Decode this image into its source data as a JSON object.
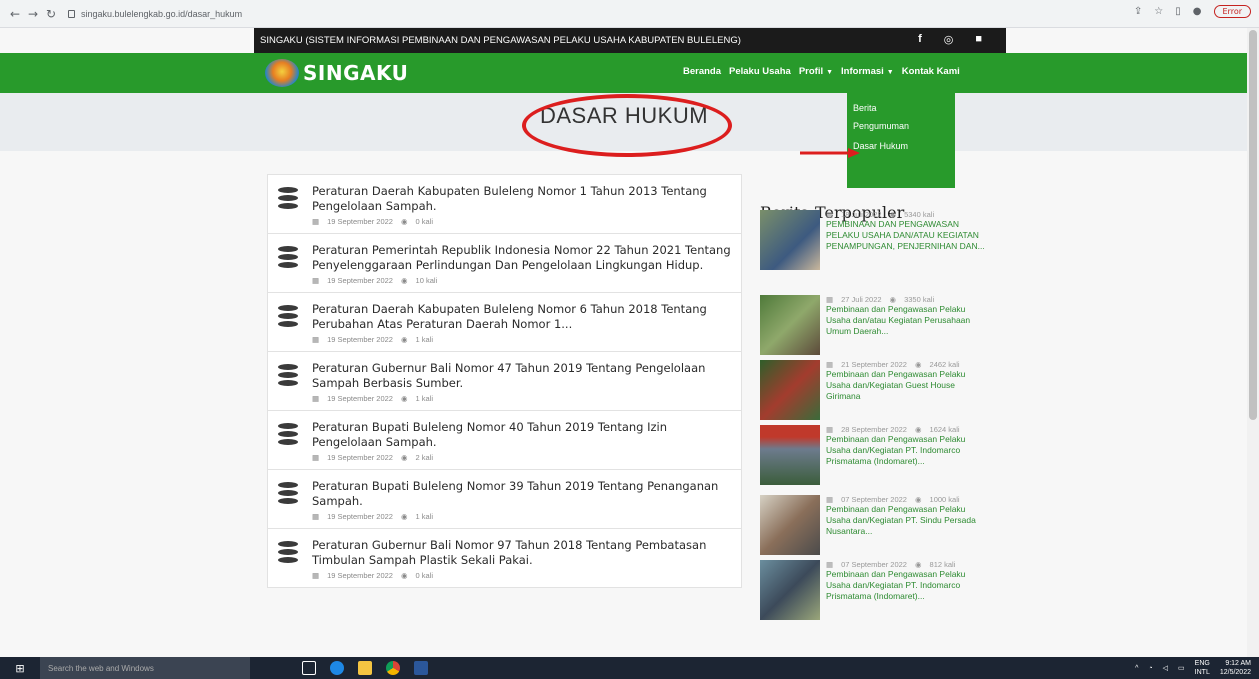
{
  "browser": {
    "url": "singaku.bulelengkab.go.id/dasar_hukum",
    "error_label": "Error"
  },
  "topbar": {
    "title": "SINGAKU (SISTEM INFORMASI PEMBINAAN DAN PENGAWASAN PELAKU USAHA KABUPATEN BULELENG)"
  },
  "brand": {
    "name": "SINGAKU"
  },
  "menu": {
    "beranda": "Beranda",
    "pelaku": "Pelaku Usaha",
    "profil": "Profil",
    "informasi": "Informasi",
    "kontak": "Kontak Kami"
  },
  "dropdown": {
    "items": [
      "Berita",
      "Pengumuman",
      "Dasar Hukum"
    ]
  },
  "page": {
    "title": "DASAR HUKUM"
  },
  "laws": [
    {
      "title": "Peraturan Daerah Kabupaten Buleleng Nomor 1 Tahun 2013 Tentang Pengelolaan Sampah.",
      "date": "19 September 2022",
      "views": "0 kali"
    },
    {
      "title": "Peraturan Pemerintah Republik Indonesia Nomor 22 Tahun 2021 Tentang Penyelenggaraan Perlindungan Dan Pengelolaan Lingkungan Hidup.",
      "date": "19 September 2022",
      "views": "10 kali"
    },
    {
      "title": "Peraturan Daerah Kabupaten Buleleng Nomor 6 Tahun 2018 Tentang Perubahan Atas Peraturan Daerah Nomor 1...",
      "date": "19 September 2022",
      "views": "1 kali"
    },
    {
      "title": "Peraturan Gubernur Bali Nomor 47 Tahun 2019 Tentang Pengelolaan Sampah Berbasis Sumber.",
      "date": "19 September 2022",
      "views": "1 kali"
    },
    {
      "title": "Peraturan Bupati Buleleng Nomor 40 Tahun 2019 Tentang Izin Pengelolaan Sampah.",
      "date": "19 September 2022",
      "views": "2 kali"
    },
    {
      "title": "Peraturan Bupati Buleleng Nomor 39 Tahun 2019 Tentang Penanganan Sampah.",
      "date": "19 September 2022",
      "views": "1 kali"
    },
    {
      "title": "Peraturan Gubernur Bali Nomor 97 Tahun 2018 Tentang Pembatasan Timbulan Sampah Plastik Sekali Pakai.",
      "date": "19 September 2022",
      "views": "0 kali"
    }
  ],
  "popular": {
    "heading": "Berita Terpopuler",
    "items": [
      {
        "date": "18 Juli 2022",
        "views": "5340 kali",
        "text": "PEMBINAAN DAN PENGAWASAN PELAKU USAHA DAN/ATAU KEGIATAN PENAMPUNGAN, PENJERNIHAN DAN..."
      },
      {
        "date": "27 Juli 2022",
        "views": "3350 kali",
        "text": "Pembinaan dan Pengawasan Pelaku Usaha dan/atau Kegiatan Perusahaan Umum Daerah..."
      },
      {
        "date": "21 September 2022",
        "views": "2462 kali",
        "text": "Pembinaan dan Pengawasan Pelaku Usaha dan/Kegiatan Guest House Girimana"
      },
      {
        "date": "28 September 2022",
        "views": "1624 kali",
        "text": "Pembinaan dan Pengawasan Pelaku Usaha dan/Kegiatan PT. Indomarco Prismatama (Indomaret)..."
      },
      {
        "date": "07 September 2022",
        "views": "1000 kali",
        "text": "Pembinaan dan Pengawasan Pelaku Usaha dan/Kegiatan PT. Sindu Persada Nusantara..."
      },
      {
        "date": "07 September 2022",
        "views": "812 kali",
        "text": "Pembinaan dan Pengawasan Pelaku Usaha dan/Kegiatan PT. Indomarco Prismatama (Indomaret)..."
      }
    ]
  },
  "taskbar": {
    "search_placeholder": "Search the web and Windows",
    "lang": "ENG",
    "lang_sub": "INTL",
    "time": "9:12 AM",
    "date": "12/5/2022"
  },
  "colors": {
    "green": "#289a2b",
    "topbar": "#1b1b1b",
    "annotation_red": "#dc1e1e"
  }
}
